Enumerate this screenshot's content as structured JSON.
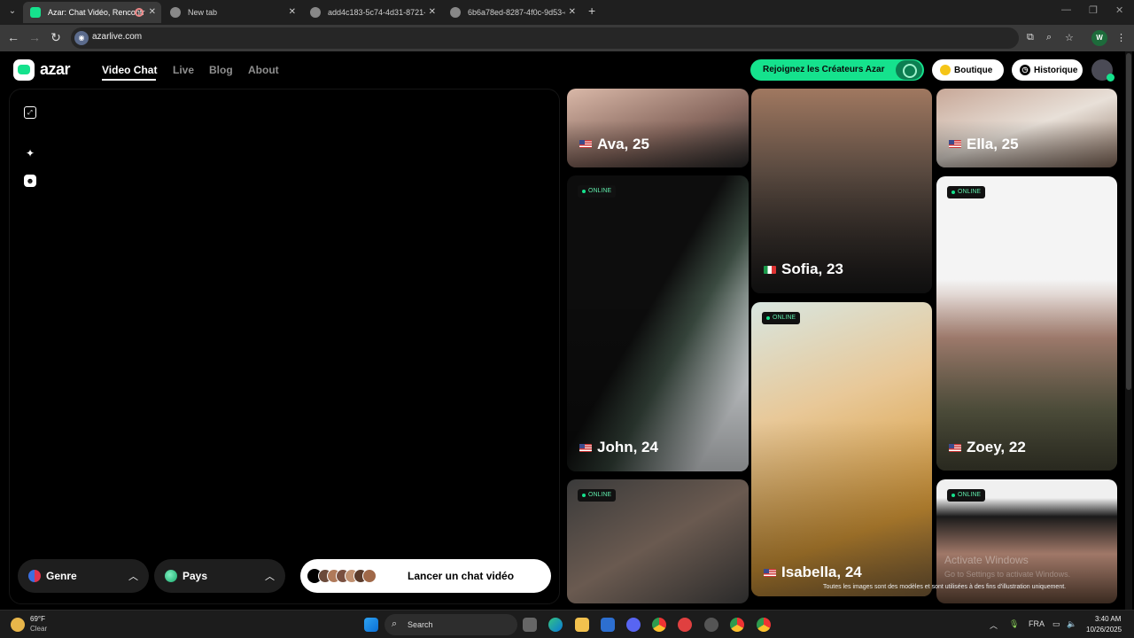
{
  "browser": {
    "tabs": [
      {
        "title": "Azar: Chat Vidéo, Rencontr",
        "active": true
      },
      {
        "title": "New tab",
        "active": false
      },
      {
        "title": "add4c183-5c74-4d31-8721-f25",
        "active": false
      },
      {
        "title": "6b6a78ed-8287-4f0c-9d53-e4f",
        "active": false
      }
    ],
    "url": "azarlive.com",
    "profile_initial": "W"
  },
  "header": {
    "logo": "azar",
    "nav": [
      "Video Chat",
      "Live",
      "Blog",
      "About"
    ],
    "creators_label": "Rejoignez les Créateurs Azar",
    "shop_label": "Boutique",
    "history_label": "Historique"
  },
  "filters": {
    "gender_label": "Genre",
    "country_label": "Pays",
    "start_label": "Lancer un chat vidéo"
  },
  "profiles": [
    {
      "name": "Ava, 25",
      "flag": "us",
      "online": false
    },
    {
      "name": "Sofia, 23",
      "flag": "it",
      "online": false
    },
    {
      "name": "Ella, 25",
      "flag": "us",
      "online": false
    },
    {
      "name": "John, 24",
      "flag": "us",
      "online": true
    },
    {
      "name": "Isabella, 24",
      "flag": "us",
      "online": true
    },
    {
      "name": "Zoey, 22",
      "flag": "us",
      "online": true
    },
    {
      "name": "",
      "flag": "",
      "online": true
    },
    {
      "name": "",
      "flag": "",
      "online": true
    }
  ],
  "online_label": "ONLINE",
  "watermark": {
    "line1": "Activate Windows",
    "line2": "Go to Settings to activate Windows."
  },
  "disclaimer": "Toutes les images sont des modèles et sont utilisées à des fins d'illustration uniquement.",
  "taskbar": {
    "temp": "69°F",
    "condition": "Clear",
    "search_placeholder": "Search",
    "lang": "FRA",
    "time": "3:40 AM",
    "date": "10/26/2025"
  },
  "colors": {
    "accent": "#15e28d",
    "background": "#000000"
  }
}
